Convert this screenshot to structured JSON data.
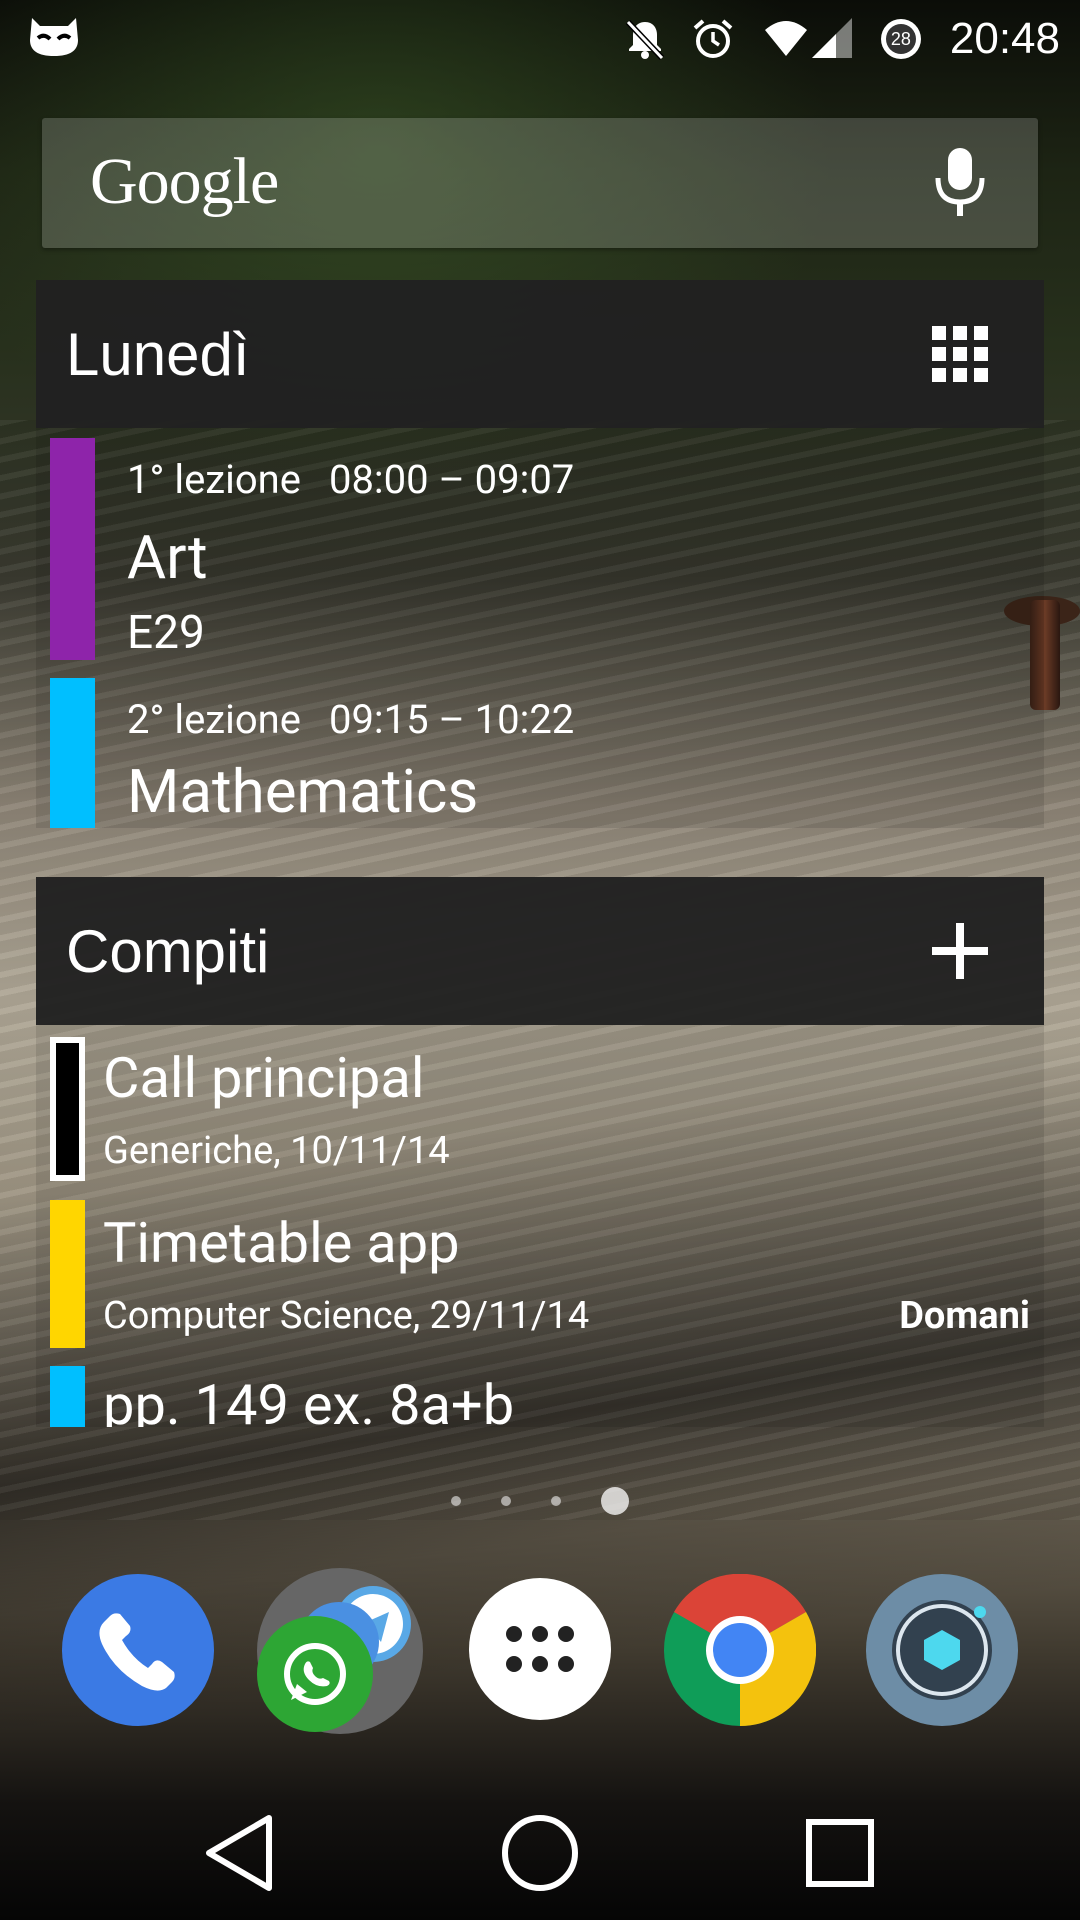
{
  "status_bar": {
    "time": "20:48",
    "badge_count": "28",
    "icons": [
      "cyanogenmod-icon",
      "notifications-muted-icon",
      "alarm-icon",
      "wifi-icon",
      "signal-icon",
      "badge-icon"
    ]
  },
  "search": {
    "logo_text": "Google",
    "icons": [
      "mic-icon"
    ]
  },
  "timetable_widget": {
    "title": "Lunedì",
    "header_icon": "grid-icon",
    "lessons": [
      {
        "number": "1° lezione",
        "time": "08:00 – 09:07",
        "subject": "Art",
        "room": "E29",
        "color": "#8E24AA"
      },
      {
        "number": "2° lezione",
        "time": "09:15 – 10:22",
        "subject": "Mathematics",
        "room": "",
        "color": "#00BFFF"
      }
    ]
  },
  "tasks_widget": {
    "title": "Compiti",
    "header_icon": "add-icon",
    "tasks": [
      {
        "title": "Call principal",
        "subtitle": "Generiche, 10/11/14",
        "due": "",
        "color": "#000000"
      },
      {
        "title": "Timetable app",
        "subtitle": "Computer Science, 29/11/14",
        "due": "Domani",
        "color": "#FFD600"
      },
      {
        "title": "pp. 149 ex. 8a+b",
        "subtitle": "",
        "due": "",
        "color": "#00BFFF"
      }
    ]
  },
  "page_indicator": {
    "count": 4,
    "active": 4
  },
  "dock": [
    {
      "name": "phone-icon"
    },
    {
      "name": "messaging-folder-icon"
    },
    {
      "name": "app-drawer-icon"
    },
    {
      "name": "chrome-icon"
    },
    {
      "name": "camera-icon"
    }
  ],
  "navigation": [
    "back-icon",
    "home-icon",
    "recents-icon"
  ],
  "colors": {
    "widget_header": "#212121",
    "phone": "#3B7AE4",
    "whatsapp": "#2DA634",
    "chrome_red": "#DB4437",
    "chrome_green": "#0F9D58",
    "chrome_yellow": "#F4C20D",
    "chrome_blue": "#4285F4",
    "camera": "#6D8DA6"
  }
}
